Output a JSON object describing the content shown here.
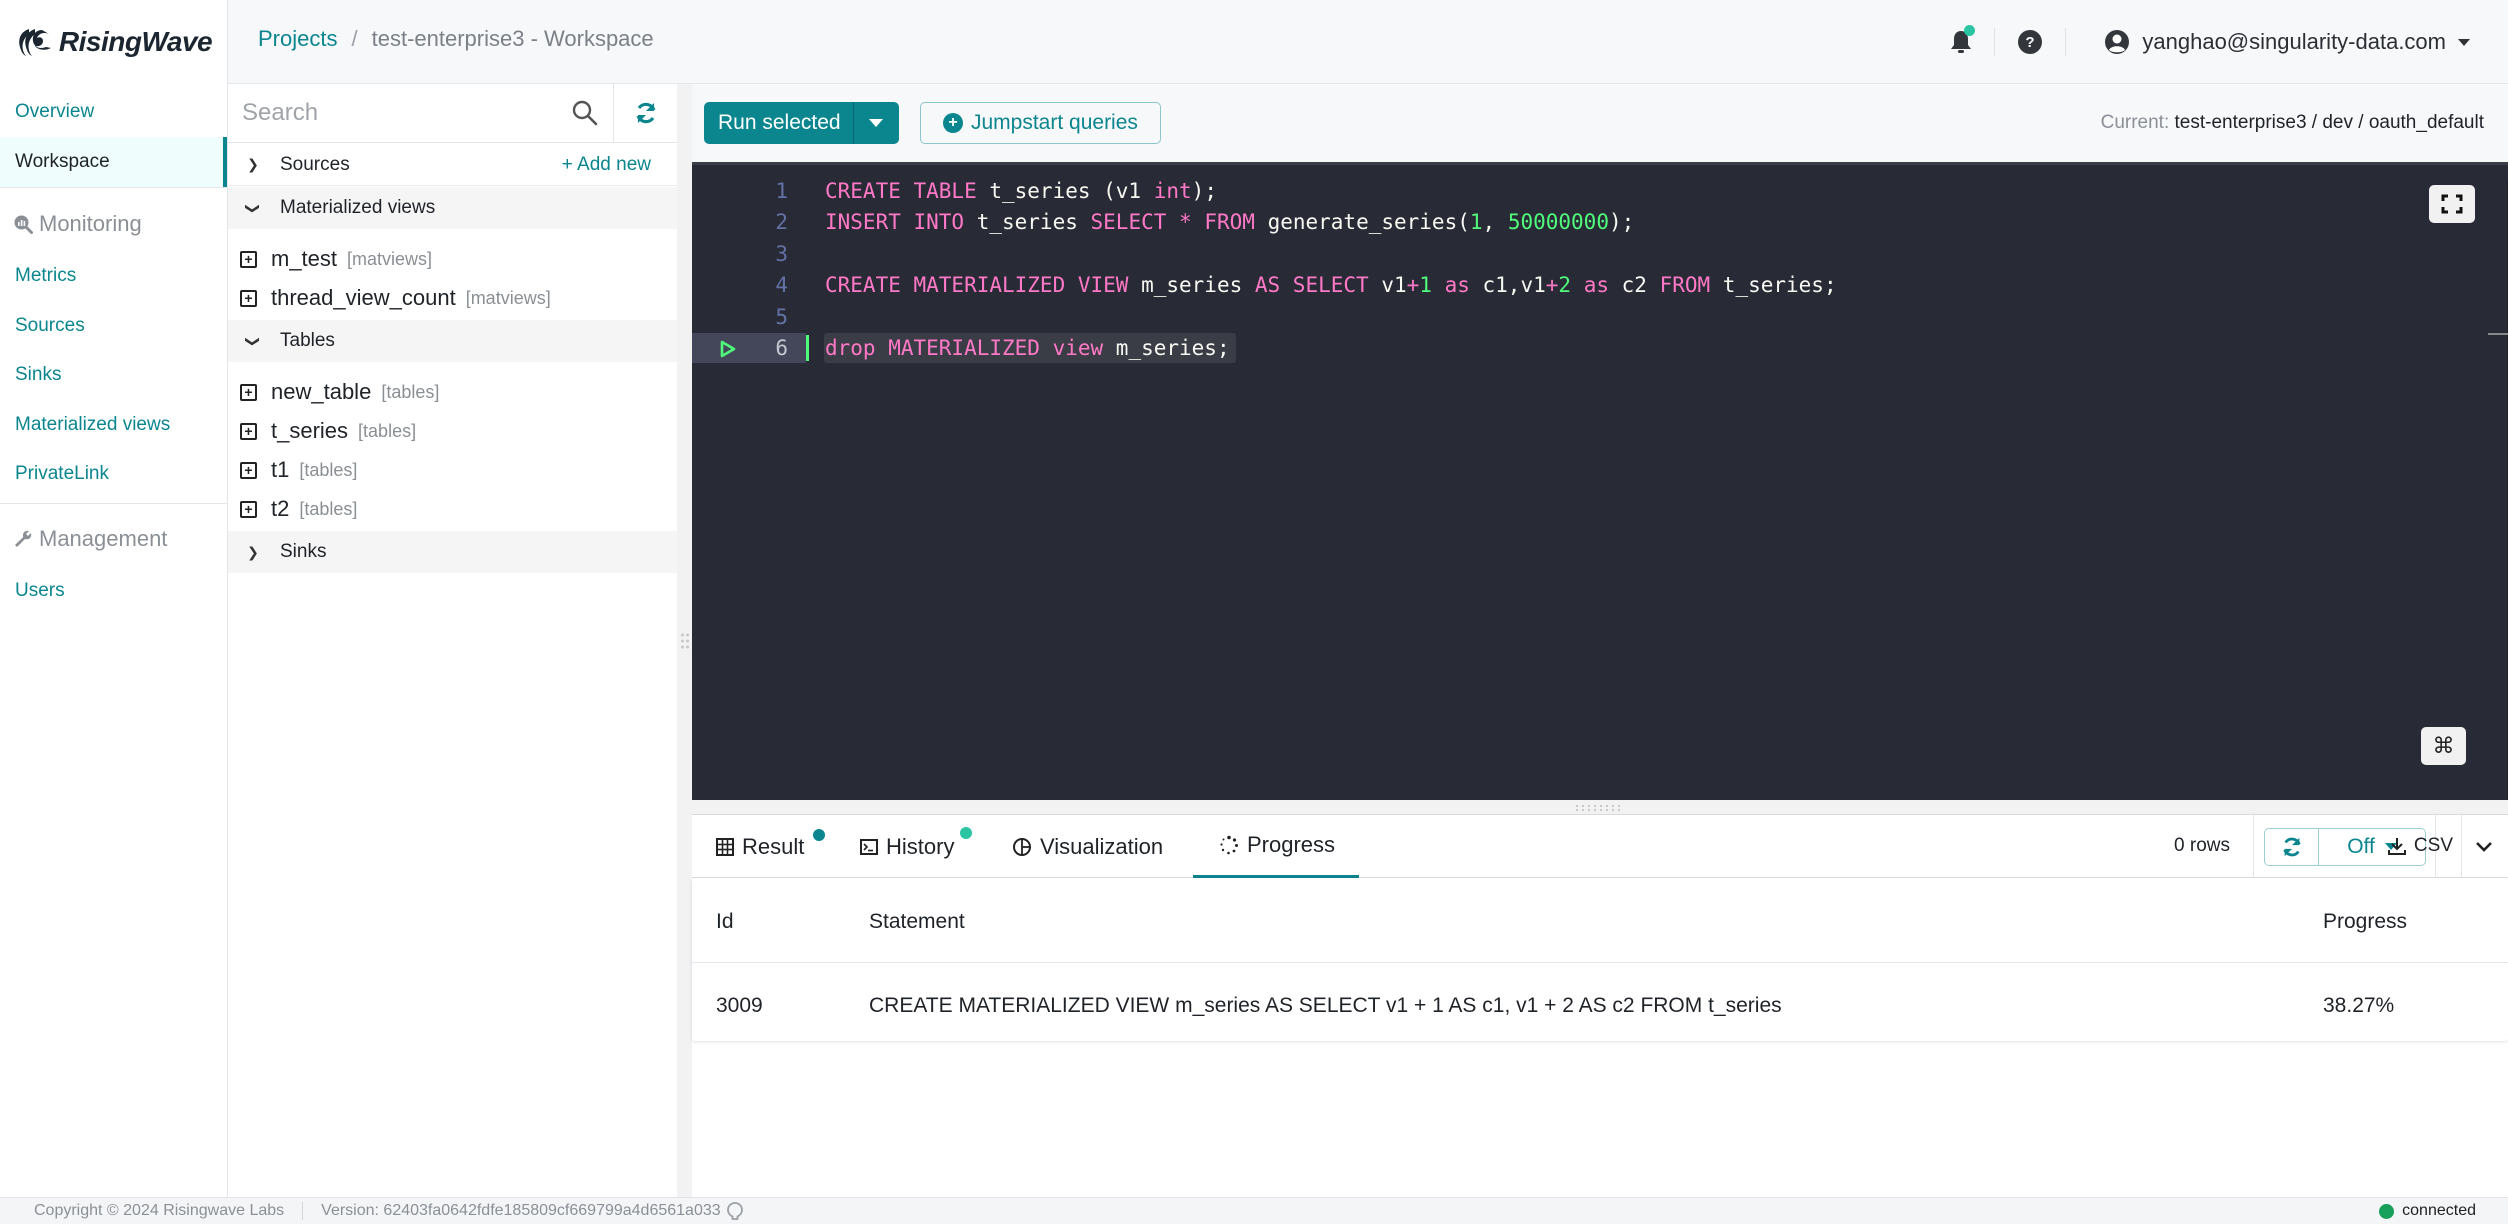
{
  "app": {
    "name": "RisingWave"
  },
  "header": {
    "breadcrumb": {
      "root": "Projects",
      "separator": "/",
      "current": "test-enterprise3 - Workspace"
    },
    "user_email": "yanghao@singularity-data.com",
    "icons": {
      "notifications": "bell-icon",
      "help": "question-icon",
      "user": "user-circle-icon"
    },
    "notification_dot_color": "#2bc5a3"
  },
  "sidebar": {
    "items": [
      {
        "label": "Overview",
        "active": false
      },
      {
        "label": "Workspace",
        "active": true
      }
    ],
    "monitoring": {
      "label": "Monitoring",
      "icon": "monitoring-search-icon",
      "items": [
        {
          "label": "Metrics"
        },
        {
          "label": "Sources"
        },
        {
          "label": "Sinks"
        },
        {
          "label": "Materialized views"
        },
        {
          "label": "PrivateLink"
        }
      ]
    },
    "management": {
      "label": "Management",
      "icon": "wrench-icon",
      "items": [
        {
          "label": "Users"
        }
      ]
    }
  },
  "tree": {
    "search_placeholder": "Search",
    "sections": [
      {
        "label": "Sources",
        "expanded": false,
        "action": "+ Add new",
        "items": []
      },
      {
        "label": "Materialized views",
        "expanded": true,
        "items": [
          {
            "name": "m_test",
            "tag": "[matviews]"
          },
          {
            "name": "thread_view_count",
            "tag": "[matviews]"
          }
        ]
      },
      {
        "label": "Tables",
        "expanded": true,
        "items": [
          {
            "name": "new_table",
            "tag": "[tables]"
          },
          {
            "name": "t_series",
            "tag": "[tables]"
          },
          {
            "name": "t1",
            "tag": "[tables]"
          },
          {
            "name": "t2",
            "tag": "[tables]"
          }
        ]
      },
      {
        "label": "Sinks",
        "expanded": false,
        "items": []
      }
    ]
  },
  "toolbar": {
    "run_label": "Run selected",
    "jumpstart_label": "Jumpstart queries",
    "current_label": "Current:",
    "current_value": "test-enterprise3 / dev / oauth_default"
  },
  "editor": {
    "active_line": 6,
    "lines": [
      {
        "n": "1",
        "text": "CREATE TABLE t_series (v1 int);"
      },
      {
        "n": "2",
        "text": "INSERT INTO t_series SELECT * FROM generate_series(1, 50000000);"
      },
      {
        "n": "3",
        "text": ""
      },
      {
        "n": "4",
        "text": "CREATE MATERIALIZED VIEW m_series AS SELECT v1+1 as c1,v1+2 as c2 FROM t_series;"
      },
      {
        "n": "5",
        "text": ""
      },
      {
        "n": "6",
        "text": "drop MATERIALIZED view m_series;"
      }
    ],
    "colors": {
      "background": "#282a36",
      "keyword": "#ff79c6",
      "number": "#50fa7b",
      "text": "#f8f8f2",
      "line_number": "#6272a4"
    }
  },
  "results": {
    "tabs": [
      {
        "label": "Result",
        "icon": "table-grid-icon",
        "dot": "#0b868f"
      },
      {
        "label": "History",
        "icon": "terminal-icon",
        "dot": "#2bc5a3"
      },
      {
        "label": "Visualization",
        "icon": "pie-chart-icon"
      },
      {
        "label": "Progress",
        "icon": "spinner-icon",
        "active": true
      }
    ],
    "rows_label": "0 rows",
    "auto_refresh_value": "Off",
    "csv_label": "CSV",
    "columns": [
      "Id",
      "Statement",
      "Progress"
    ],
    "rows": [
      {
        "id": "3009",
        "statement": "CREATE MATERIALIZED VIEW m_series AS SELECT v1 + 1 AS c1, v1 + 2 AS c2 FROM t_series",
        "progress": "38.27%"
      }
    ]
  },
  "footer": {
    "copyright": "Copyright © 2024 Risingwave Labs",
    "version": "Version: 62403fa0642fdfe185809cf669799a4d6561a033",
    "status": "connected",
    "status_color": "#16a05c"
  },
  "colors": {
    "brand": "#0b868f",
    "active_nav_bg": "#effdfd"
  }
}
